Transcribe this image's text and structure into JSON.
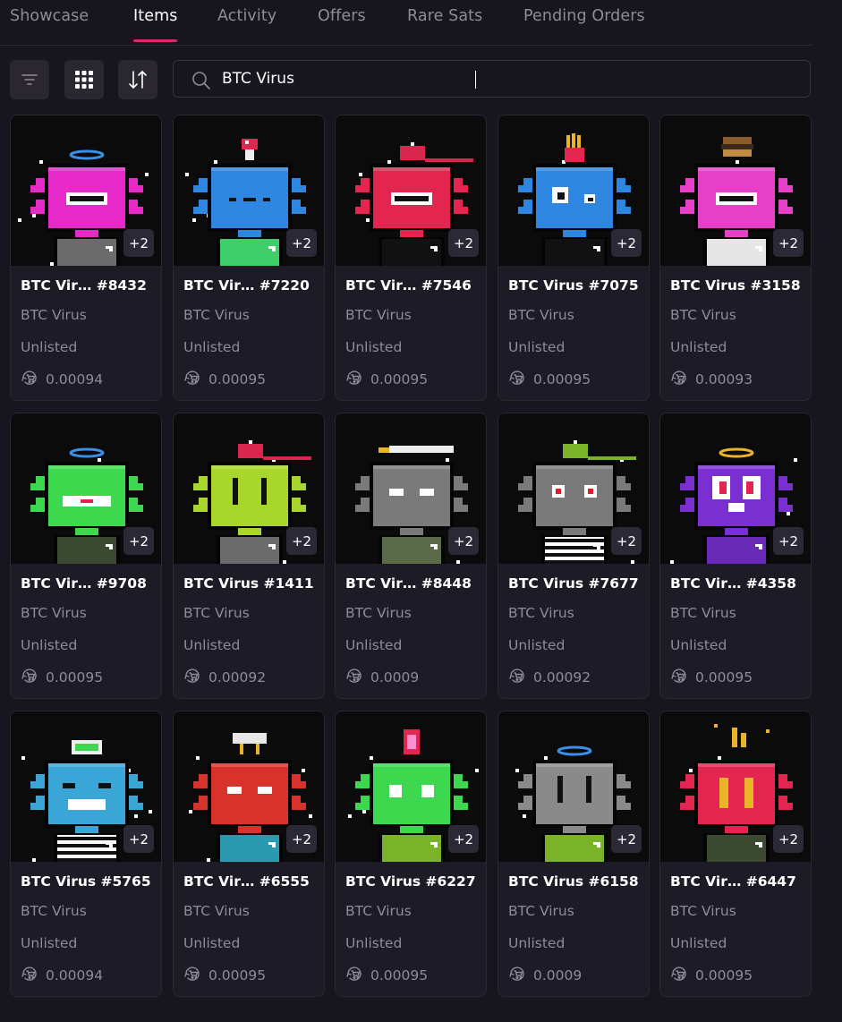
{
  "tabs": [
    {
      "label": "Showcase",
      "active": false
    },
    {
      "label": "Items",
      "active": true
    },
    {
      "label": "Activity",
      "active": false
    },
    {
      "label": "Offers",
      "active": false
    },
    {
      "label": "Rare Sats",
      "active": false
    },
    {
      "label": "Pending Orders",
      "active": false
    }
  ],
  "toolbar": {
    "filter_icon": "filter-lines-icon",
    "grid_icon": "grid-view-icon",
    "sort_icon": "sort-arrows-icon"
  },
  "search": {
    "value": "BTC Virus",
    "icon": "search-icon"
  },
  "colors": {
    "accent": "#e0266d",
    "background": "#17151e",
    "card": "#1d1b25"
  },
  "items": [
    {
      "name": "BTC Vir…  #8432",
      "collection": "BTC Virus",
      "status": "Unlisted",
      "price": "0.00094",
      "badge": "+2",
      "body": "#e629c8",
      "shirt": "#6b6b6b",
      "hat": "halo",
      "face": "mouth-open"
    },
    {
      "name": "BTC Vir…  #7220",
      "collection": "BTC Virus",
      "status": "Unlisted",
      "price": "0.00095",
      "badge": "+2",
      "body": "#2f86e0",
      "shirt": "#3fcf6a",
      "hat": "mushroom",
      "face": "dash"
    },
    {
      "name": "BTC Vir…  #7546",
      "collection": "BTC Virus",
      "status": "Unlisted",
      "price": "0.00095",
      "badge": "+2",
      "body": "#e2264f",
      "shirt": "#111111",
      "hat": "cap-red",
      "face": "mouth-open"
    },
    {
      "name": "BTC Virus #7075",
      "collection": "BTC Virus",
      "status": "Unlisted",
      "price": "0.00095",
      "badge": "+2",
      "body": "#2f86e0",
      "shirt": "#111111",
      "hat": "fries",
      "face": "eyes-round"
    },
    {
      "name": "BTC Virus #3158",
      "collection": "BTC Virus",
      "status": "Unlisted",
      "price": "0.00093",
      "badge": "+2",
      "body": "#e63fc8",
      "shirt": "#e6e6e6",
      "hat": "burger",
      "face": "bar"
    },
    {
      "name": "BTC Vir…  #9708",
      "collection": "BTC Virus",
      "status": "Unlisted",
      "price": "0.00095",
      "badge": "+2",
      "body": "#3ed84e",
      "shirt": "#3b4a30",
      "hat": "halo",
      "face": "mouth-red"
    },
    {
      "name": "BTC Virus #1411",
      "collection": "BTC Virus",
      "status": "Unlisted",
      "price": "0.00092",
      "badge": "+2",
      "body": "#a9d62a",
      "shirt": "#6b6b6b",
      "hat": "cap-red",
      "face": "lines"
    },
    {
      "name": "BTC Vir…  #8448",
      "collection": "BTC Virus",
      "status": "Unlisted",
      "price": "0.0009",
      "badge": "+2",
      "body": "#7a7a7a",
      "shirt": "#5b6b4a",
      "hat": "sword",
      "face": "eyes-white"
    },
    {
      "name": "BTC Virus #7677",
      "collection": "BTC Virus",
      "status": "Unlisted",
      "price": "0.00092",
      "badge": "+2",
      "body": "#7a7a7a",
      "shirt": "#ffffff",
      "hat": "cap-green",
      "face": "eyes-red"
    },
    {
      "name": "BTC Vir…  #4358",
      "collection": "BTC Virus",
      "status": "Unlisted",
      "price": "0.00095",
      "badge": "+2",
      "body": "#7a2fd0",
      "shirt": "#6a2ab8",
      "hat": "halo-gold",
      "face": "eyes-big"
    },
    {
      "name": "BTC Virus #5765",
      "collection": "BTC Virus",
      "status": "Unlisted",
      "price": "0.00094",
      "badge": "+2",
      "body": "#3aa6d8",
      "shirt": "#ffffff",
      "hat": "battery",
      "face": "smile"
    },
    {
      "name": "BTC Vir…  #6555",
      "collection": "BTC Virus",
      "status": "Unlisted",
      "price": "0.00095",
      "badge": "+2",
      "body": "#d8322c",
      "shirt": "#2a9ab0",
      "hat": "cloud",
      "face": "eyes-white"
    },
    {
      "name": "BTC Virus #6227",
      "collection": "BTC Virus",
      "status": "Unlisted",
      "price": "0.00095",
      "badge": "+2",
      "body": "#3ed84e",
      "shirt": "#7ab32a",
      "hat": "flame",
      "face": "eyes-square"
    },
    {
      "name": "BTC Virus #6158",
      "collection": "BTC Virus",
      "status": "Unlisted",
      "price": "0.0009",
      "badge": "+2",
      "body": "#8a8a8a",
      "shirt": "#7ab32a",
      "hat": "halo",
      "face": "lines"
    },
    {
      "name": "BTC Vir…  #6447",
      "collection": "BTC Virus",
      "status": "Unlisted",
      "price": "0.00095",
      "badge": "+2",
      "body": "#e2264f",
      "shirt": "#3b4a30",
      "hat": "sparks",
      "face": "bars-gold"
    }
  ]
}
